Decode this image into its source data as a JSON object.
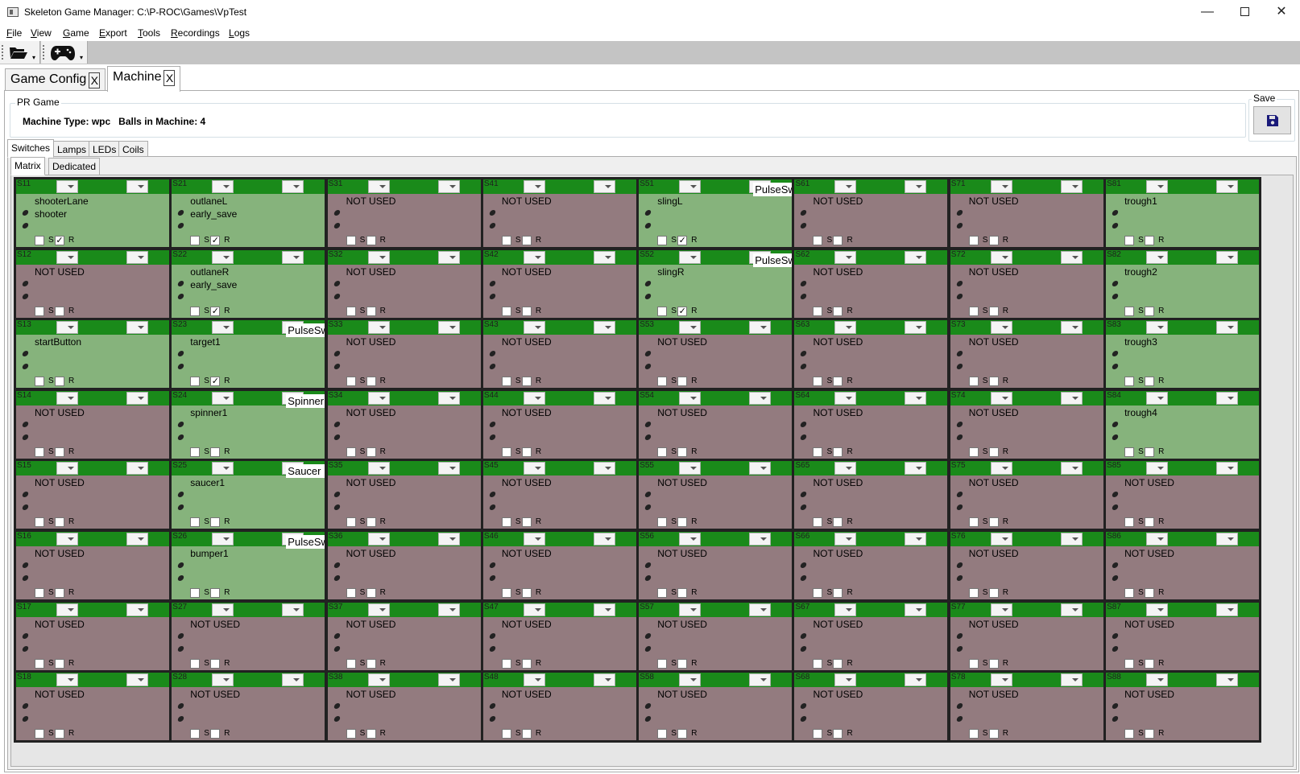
{
  "window": {
    "title": "Skeleton Game Manager: C:\\P-ROC\\Games\\VpTest",
    "minimize": "—",
    "close": "✕"
  },
  "menu": [
    "File",
    "View",
    "Game",
    "Export",
    "Tools",
    "Recordings",
    "Logs"
  ],
  "toolbar": {
    "open_icon": "folder-open-icon",
    "game_icon": "gamepad-icon"
  },
  "doc_tabs": [
    {
      "label": "Game Config",
      "close": "X"
    },
    {
      "label": "Machine",
      "close": "X",
      "active": true
    }
  ],
  "pr_game": {
    "legend": "PR Game",
    "machine_type_label": "Machine Type:",
    "machine_type": "wpc",
    "balls_label": "Balls in Machine:",
    "balls": "4"
  },
  "save": {
    "legend": "Save",
    "icon": "floppy-disk-icon"
  },
  "tabs": [
    "Switches",
    "Lamps",
    "LEDs",
    "Coils"
  ],
  "subtabs": [
    "Matrix",
    "Dedicated"
  ],
  "colors": {
    "used": "#86b37c",
    "unused": "#937b7f",
    "header": "#1a8a1a",
    "save_icon": "#1a1a7a"
  },
  "checkbox_labels": {
    "s": "S",
    "r": "R"
  },
  "switches": [
    [
      {
        "num": "S11",
        "name": "shooterLane",
        "tag": "shooter",
        "used": true,
        "s": false,
        "r": true
      },
      {
        "num": "S21",
        "name": "outlaneL",
        "tag": "early_save",
        "used": true,
        "s": false,
        "r": true
      },
      {
        "num": "S31",
        "name": "NOT USED",
        "used": false,
        "s": false,
        "r": false
      },
      {
        "num": "S41",
        "name": "NOT USED",
        "used": false,
        "s": false,
        "r": false
      },
      {
        "num": "S51",
        "name": "slingL",
        "type": "PulseSw",
        "used": true,
        "s": false,
        "r": true
      },
      {
        "num": "S61",
        "name": "NOT USED",
        "used": false,
        "s": false,
        "r": false
      },
      {
        "num": "S71",
        "name": "NOT USED",
        "used": false,
        "s": false,
        "r": false
      },
      {
        "num": "S81",
        "name": "trough1",
        "used": true,
        "s": false,
        "r": false
      }
    ],
    [
      {
        "num": "S12",
        "name": "NOT USED",
        "used": false,
        "s": false,
        "r": false
      },
      {
        "num": "S22",
        "name": "outlaneR",
        "tag": "early_save",
        "used": true,
        "s": false,
        "r": true
      },
      {
        "num": "S32",
        "name": "NOT USED",
        "used": false,
        "s": false,
        "r": false
      },
      {
        "num": "S42",
        "name": "NOT USED",
        "used": false,
        "s": false,
        "r": false
      },
      {
        "num": "S52",
        "name": "slingR",
        "type": "PulseSw",
        "used": true,
        "s": false,
        "r": true
      },
      {
        "num": "S62",
        "name": "NOT USED",
        "used": false,
        "s": false,
        "r": false
      },
      {
        "num": "S72",
        "name": "NOT USED",
        "used": false,
        "s": false,
        "r": false
      },
      {
        "num": "S82",
        "name": "trough2",
        "used": true,
        "s": false,
        "r": false
      }
    ],
    [
      {
        "num": "S13",
        "name": "startButton",
        "used": true,
        "s": false,
        "r": false
      },
      {
        "num": "S23",
        "name": "target1",
        "type": "PulseSw",
        "used": true,
        "s": false,
        "r": true
      },
      {
        "num": "S33",
        "name": "NOT USED",
        "used": false,
        "s": false,
        "r": false
      },
      {
        "num": "S43",
        "name": "NOT USED",
        "used": false,
        "s": false,
        "r": false
      },
      {
        "num": "S53",
        "name": "NOT USED",
        "used": false,
        "s": false,
        "r": false
      },
      {
        "num": "S63",
        "name": "NOT USED",
        "used": false,
        "s": false,
        "r": false
      },
      {
        "num": "S73",
        "name": "NOT USED",
        "used": false,
        "s": false,
        "r": false
      },
      {
        "num": "S83",
        "name": "trough3",
        "used": true,
        "s": false,
        "r": false
      }
    ],
    [
      {
        "num": "S14",
        "name": "NOT USED",
        "used": false,
        "s": false,
        "r": false
      },
      {
        "num": "S24",
        "name": "spinner1",
        "type": "Spinner",
        "used": true,
        "s": false,
        "r": false
      },
      {
        "num": "S34",
        "name": "NOT USED",
        "used": false,
        "s": false,
        "r": false
      },
      {
        "num": "S44",
        "name": "NOT USED",
        "used": false,
        "s": false,
        "r": false
      },
      {
        "num": "S54",
        "name": "NOT USED",
        "used": false,
        "s": false,
        "r": false
      },
      {
        "num": "S64",
        "name": "NOT USED",
        "used": false,
        "s": false,
        "r": false
      },
      {
        "num": "S74",
        "name": "NOT USED",
        "used": false,
        "s": false,
        "r": false
      },
      {
        "num": "S84",
        "name": "trough4",
        "used": true,
        "s": false,
        "r": false
      }
    ],
    [
      {
        "num": "S15",
        "name": "NOT USED",
        "used": false,
        "s": false,
        "r": false
      },
      {
        "num": "S25",
        "name": "saucer1",
        "type": "Saucer",
        "used": true,
        "s": false,
        "r": false
      },
      {
        "num": "S35",
        "name": "NOT USED",
        "used": false,
        "s": false,
        "r": false
      },
      {
        "num": "S45",
        "name": "NOT USED",
        "used": false,
        "s": false,
        "r": false
      },
      {
        "num": "S55",
        "name": "NOT USED",
        "used": false,
        "s": false,
        "r": false
      },
      {
        "num": "S65",
        "name": "NOT USED",
        "used": false,
        "s": false,
        "r": false
      },
      {
        "num": "S75",
        "name": "NOT USED",
        "used": false,
        "s": false,
        "r": false
      },
      {
        "num": "S85",
        "name": "NOT USED",
        "used": false,
        "s": false,
        "r": false
      }
    ],
    [
      {
        "num": "S16",
        "name": "NOT USED",
        "used": false,
        "s": false,
        "r": false
      },
      {
        "num": "S26",
        "name": "bumper1",
        "type": "PulseSw",
        "used": true,
        "s": false,
        "r": false
      },
      {
        "num": "S36",
        "name": "NOT USED",
        "used": false,
        "s": false,
        "r": false
      },
      {
        "num": "S46",
        "name": "NOT USED",
        "used": false,
        "s": false,
        "r": false
      },
      {
        "num": "S56",
        "name": "NOT USED",
        "used": false,
        "s": false,
        "r": false
      },
      {
        "num": "S66",
        "name": "NOT USED",
        "used": false,
        "s": false,
        "r": false
      },
      {
        "num": "S76",
        "name": "NOT USED",
        "used": false,
        "s": false,
        "r": false
      },
      {
        "num": "S86",
        "name": "NOT USED",
        "used": false,
        "s": false,
        "r": false
      }
    ],
    [
      {
        "num": "S17",
        "name": "NOT USED",
        "used": false,
        "s": false,
        "r": false
      },
      {
        "num": "S27",
        "name": "NOT USED",
        "used": false,
        "s": false,
        "r": false
      },
      {
        "num": "S37",
        "name": "NOT USED",
        "used": false,
        "s": false,
        "r": false
      },
      {
        "num": "S47",
        "name": "NOT USED",
        "used": false,
        "s": false,
        "r": false
      },
      {
        "num": "S57",
        "name": "NOT USED",
        "used": false,
        "s": false,
        "r": false
      },
      {
        "num": "S67",
        "name": "NOT USED",
        "used": false,
        "s": false,
        "r": false
      },
      {
        "num": "S77",
        "name": "NOT USED",
        "used": false,
        "s": false,
        "r": false
      },
      {
        "num": "S87",
        "name": "NOT USED",
        "used": false,
        "s": false,
        "r": false
      }
    ],
    [
      {
        "num": "S18",
        "name": "NOT USED",
        "used": false,
        "s": false,
        "r": false
      },
      {
        "num": "S28",
        "name": "NOT USED",
        "used": false,
        "s": false,
        "r": false
      },
      {
        "num": "S38",
        "name": "NOT USED",
        "used": false,
        "s": false,
        "r": false
      },
      {
        "num": "S48",
        "name": "NOT USED",
        "used": false,
        "s": false,
        "r": false
      },
      {
        "num": "S58",
        "name": "NOT USED",
        "used": false,
        "s": false,
        "r": false
      },
      {
        "num": "S68",
        "name": "NOT USED",
        "used": false,
        "s": false,
        "r": false
      },
      {
        "num": "S78",
        "name": "NOT USED",
        "used": false,
        "s": false,
        "r": false
      },
      {
        "num": "S88",
        "name": "NOT USED",
        "used": false,
        "s": false,
        "r": false
      }
    ]
  ]
}
